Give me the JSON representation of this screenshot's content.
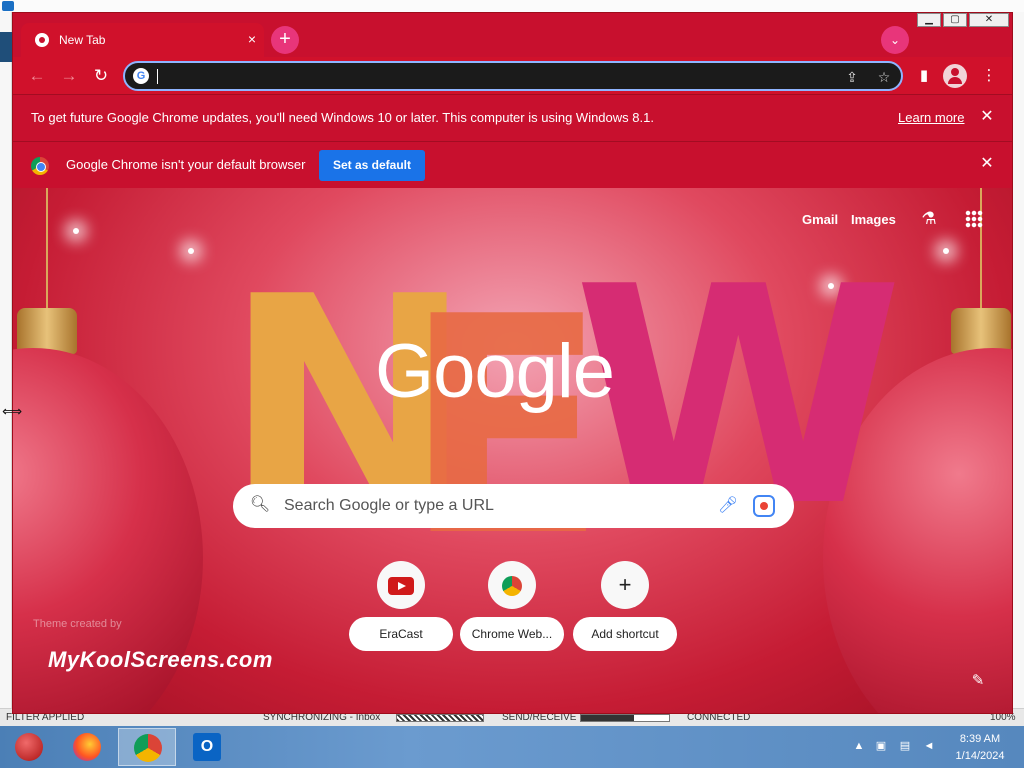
{
  "browser": {
    "tab": {
      "title": "New Tab",
      "close_glyph": "×"
    },
    "new_tab_glyph": "+",
    "tab_search_glyph": "⌄",
    "window_controls": {
      "minimize": "▁",
      "maximize": "▢",
      "close": "✕"
    },
    "toolbar": {
      "back_glyph": "←",
      "forward_glyph": "→",
      "reload_glyph": "↻",
      "omnibox_value": "",
      "side_panel_glyph": "▮",
      "menu_glyph": "⋮"
    }
  },
  "infobars": {
    "update": {
      "message": "To get future Google Chrome updates, you'll need Windows 10 or later. This computer is using Windows 8.1.",
      "link": "Learn more",
      "close_glyph": "✕"
    },
    "default_browser": {
      "message": "Google Chrome isn't your default browser",
      "button": "Set as default",
      "close_glyph": "✕"
    }
  },
  "ntp": {
    "links": {
      "gmail": "Gmail",
      "images": "Images"
    },
    "logo": "Google",
    "search": {
      "placeholder": "Search Google or type a URL"
    },
    "shortcuts": [
      {
        "label": "EraCast",
        "icon": "youtube-icon"
      },
      {
        "label": "Chrome Web...",
        "icon": "chrome-web-store-icon"
      },
      {
        "label": "Add shortcut",
        "icon": "plus-icon",
        "glyph": "+"
      }
    ],
    "theme_credit": "Theme created by",
    "watermark": "MyKoolScreens.com",
    "background_letters": [
      "N",
      "E",
      "W"
    ]
  },
  "background_app": {
    "statusbar": {
      "filter": "FILTER APPLIED",
      "sync": "SYNCHRONIZING - Inbox",
      "send_receive": "SEND/RECEIVE",
      "connected": "CONNECTED",
      "zoom": "100%"
    }
  },
  "taskbar": {
    "apps": [
      "ornament-app-icon",
      "firefox-icon",
      "chrome-icon",
      "outlook-icon"
    ],
    "clock": {
      "time": "8:39 AM",
      "date": "1/14/2024"
    }
  },
  "colors": {
    "theme_red": "#c8102e",
    "accent_blue": "#1a73e8",
    "pink_button": "#e8357a"
  }
}
